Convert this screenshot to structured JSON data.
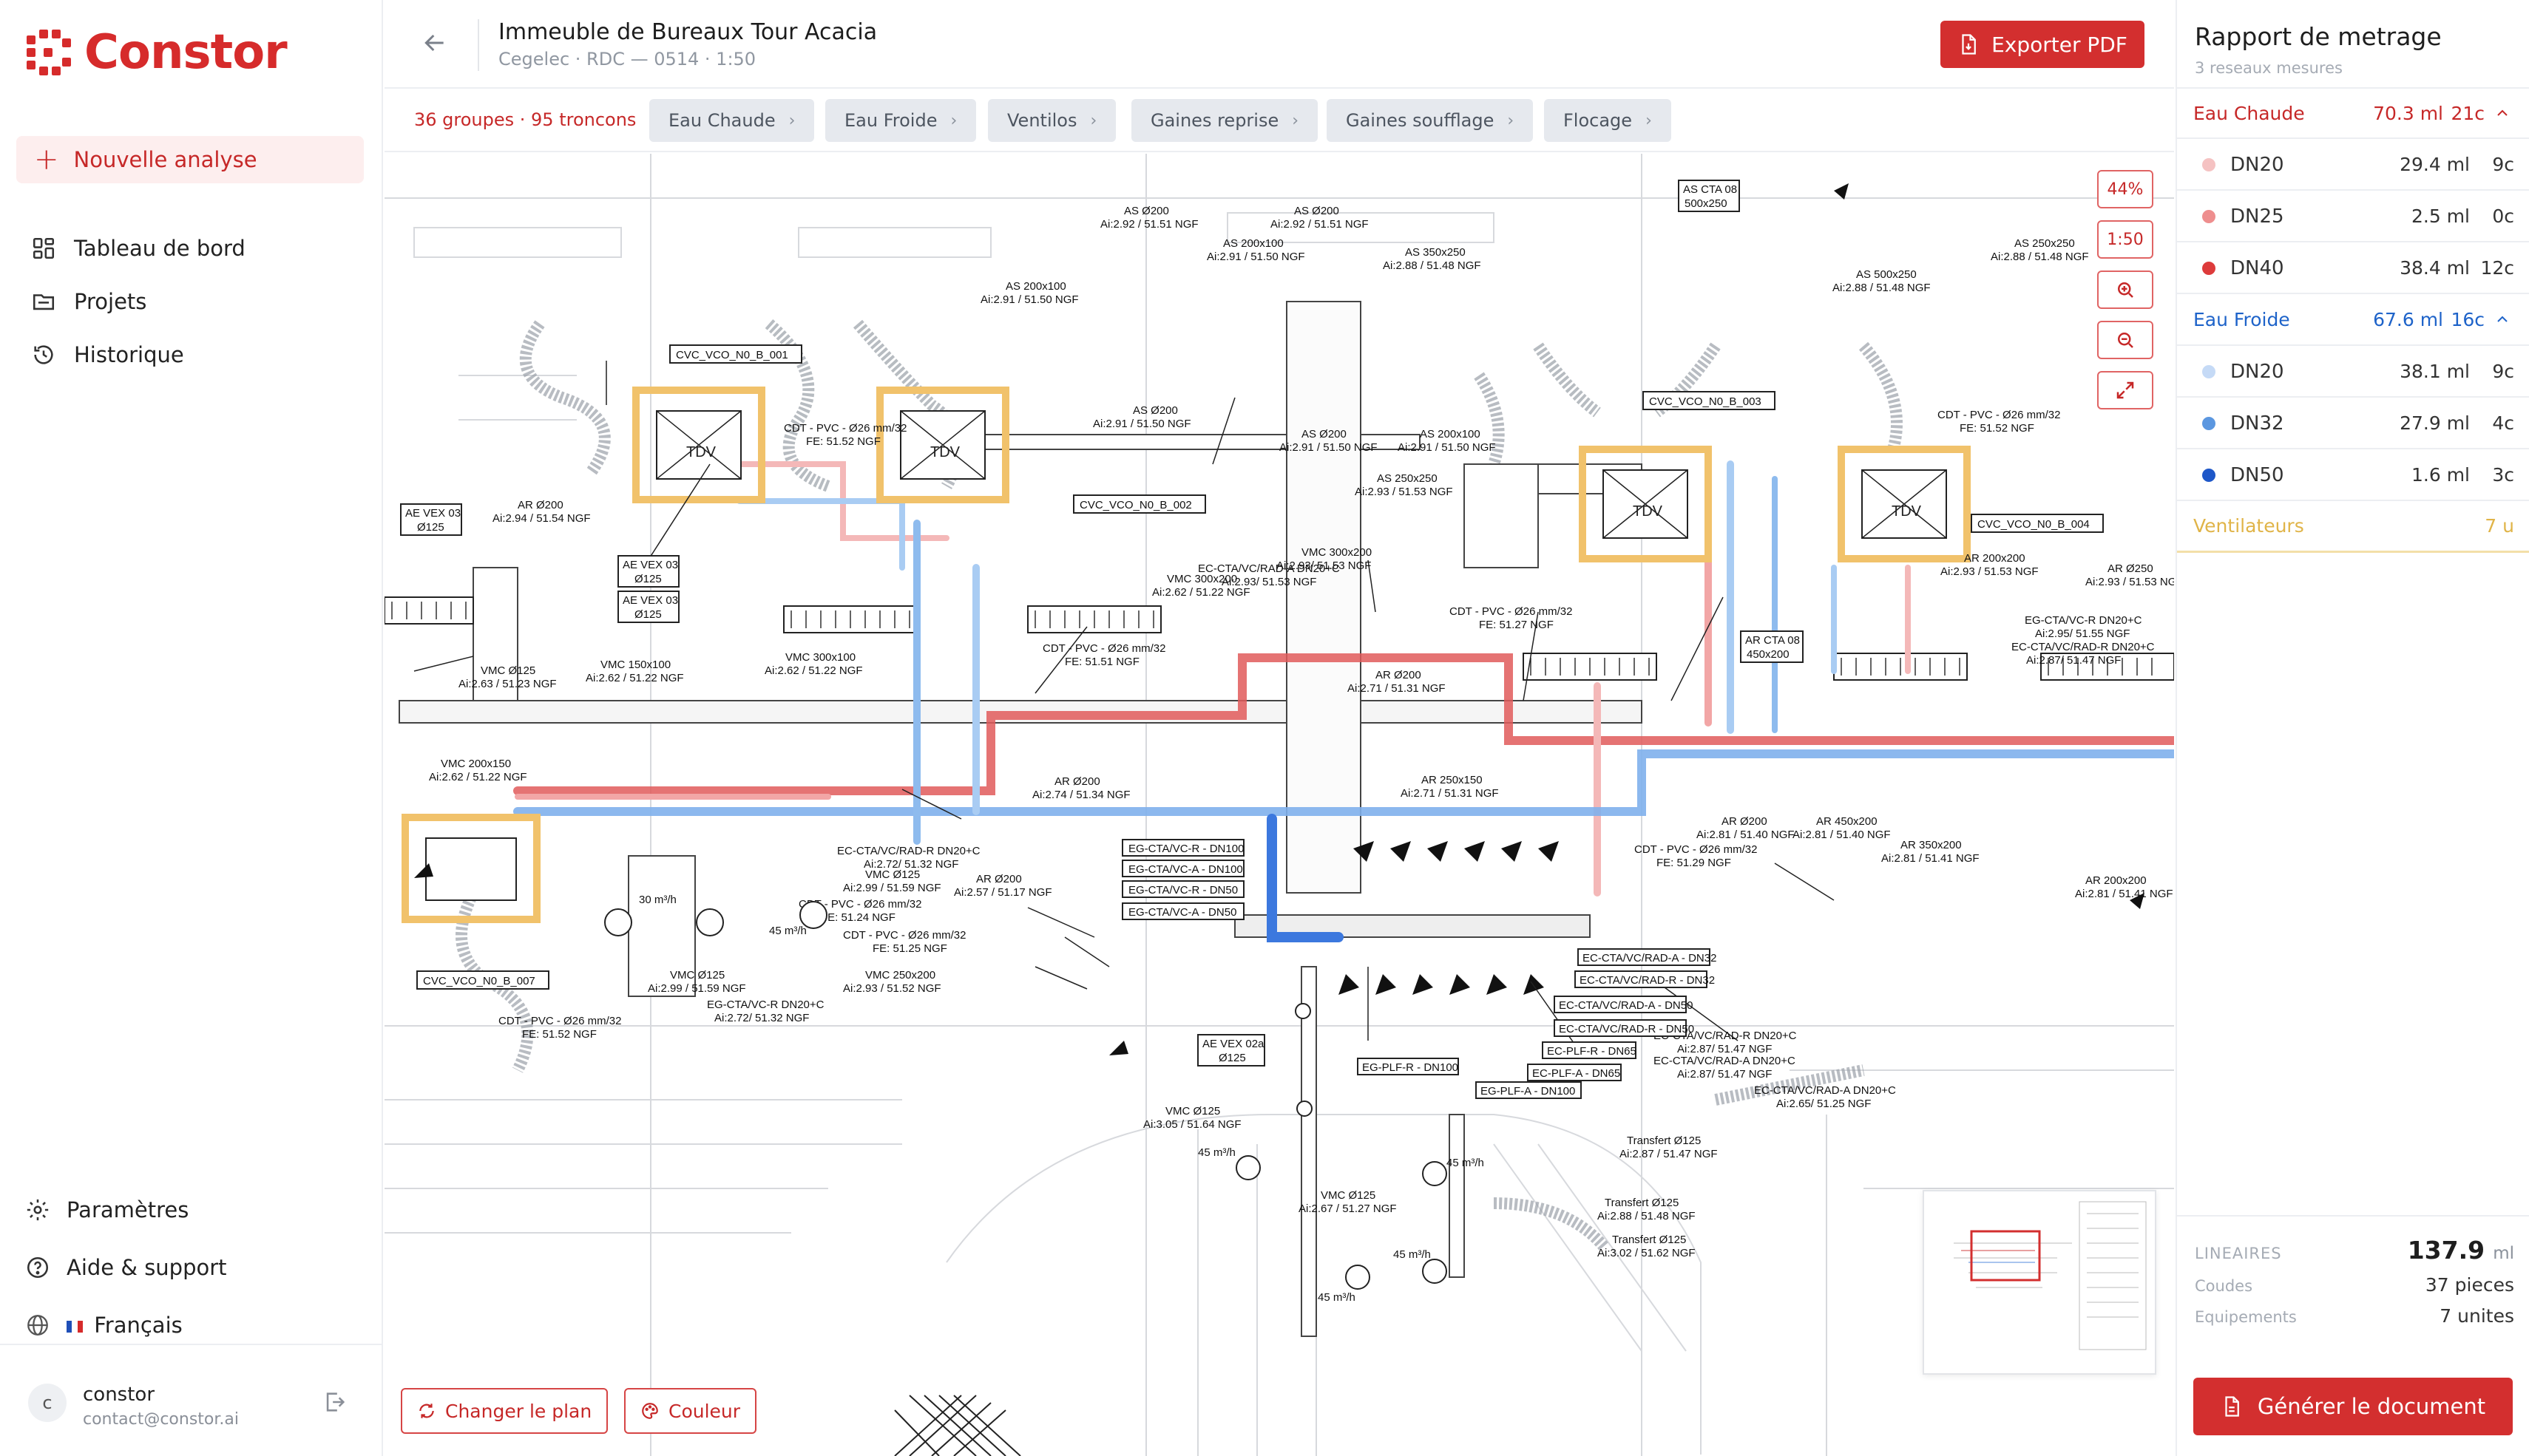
{
  "app": {
    "name": "Constor",
    "brand_color": "#d62b2b"
  },
  "sidebar": {
    "new_analysis": "Nouvelle analyse",
    "nav": [
      {
        "label": "Tableau de bord",
        "icon": "dashboard-icon"
      },
      {
        "label": "Projets",
        "icon": "folder-icon"
      },
      {
        "label": "Historique",
        "icon": "history-icon"
      }
    ],
    "bottom": [
      {
        "label": "Paramètres",
        "icon": "gear-icon"
      },
      {
        "label": "Aide & support",
        "icon": "help-icon"
      },
      {
        "label": "Français",
        "icon": "globe-icon"
      }
    ],
    "user": {
      "initial": "c",
      "name": "constor",
      "email": "contact@constor.ai"
    }
  },
  "header": {
    "title": "Immeuble de Bureaux Tour Acacia",
    "subtitle": "Cegelec · RDC — 0514 · 1:50",
    "export_label": "Exporter PDF"
  },
  "filters": {
    "count": "36 groupes · 95 troncons",
    "chips": [
      "Eau Chaude",
      "Eau Froide",
      "Ventilos",
      "Gaines reprise",
      "Gaines soufflage",
      "Flocage"
    ]
  },
  "canvas": {
    "zoom": "44%",
    "scale": "1:50",
    "change_plan": "Changer le plan",
    "color": "Couleur",
    "labels": {
      "vco_001": "CVC_VCO_N0_B_001",
      "vco_002": "CVC_VCO_N0_B_002",
      "vco_003": "CVC_VCO_N0_B_003",
      "vco_004": "CVC_VCO_N0_B_004",
      "vco_007": "CVC_VCO_N0_B_007",
      "tdv": "TDV",
      "ae_vex_03": "AE VEX 03",
      "o125": "Ø125",
      "ae_vex_02a": "AE VEX 02a",
      "as_cta_08": "AS CTA 08",
      "as_cta_08_size": "500x250",
      "ar_cta_08": "AR CTA 08",
      "ar_cta_08_size": "450x200",
      "cdt": "CDT - PVC - Ø26 mm/32",
      "fe1": "FE: 51.52 NGF",
      "fe2": "FE: 51.51 NGF",
      "fe3": "FE: 51.27 NGF",
      "fe4": "FE: 51.24 NGF",
      "fe5": "FE: 51.25 NGF",
      "fe6": "FE: 51.29 NGF",
      "as200": "AS Ø200",
      "as200_ai": "Ai:2.92 / 51.51 NGF",
      "as200x100": "AS 200x100",
      "as200x100_ai": "Ai:2.91 / 51.50 NGF",
      "as350x250": "AS 350x250",
      "as350x250_ai": "Ai:2.88 / 51.48 NGF",
      "as500x250": "AS 500x250",
      "as250x250": "AS 250x250",
      "as250x250_ai": "Ai:2.93 / 51.53 NGF",
      "ar200": "AR Ø200",
      "ar200_ai": "Ai:2.94 / 51.54 NGF",
      "ar250x150": "AR 250x150",
      "ar250x150_ai": "Ai:2.71 / 51.31 NGF",
      "ar450x200": "AR 450x200",
      "ar450x200_ai": "Ai:2.81 / 51.40 NGF",
      "ar350x200": "AR 350x200",
      "ar350x200_ai": "Ai:2.81 / 51.41 NGF",
      "ar200x200": "AR 200x200",
      "ar250": "AR Ø250",
      "vmc125": "VMC Ø125",
      "vmc125_ai": "Ai:2.63 / 51.23 NGF",
      "vmc150x100": "VMC 150x100",
      "vmc150x100_ai": "Ai:2.62 / 51.22 NGF",
      "vmc300x100": "VMC 300x100",
      "vmc300x200": "VMC 300x200",
      "vmc200x150": "VMC 200x150",
      "vmc250x200": "VMC 250x200",
      "vmc250x200_ai": "Ai:2.93 / 51.52 NGF",
      "vmc125b_ai": "Ai:2.99 / 51.59 NGF",
      "vmc125c_ai": "Ai:3.05 / 51.64 NGF",
      "vmc125d_ai": "Ai:2.67 / 51.27 NGF",
      "ec_cta": "EC-CTA/VC/RAD-A DN20+C",
      "ec_cta_ai": "Ai:2.93/ 51.53 NGF",
      "ec_cta_r": "EC-CTA/VC/RAD-R DN20+C",
      "ec_cta_r_ai": "Ai:2.72/ 51.32 NGF",
      "ec_cta_r2": "EC-CTA/VC/RAD-R DN20+C",
      "ec_cta_r2_ai": "Ai:2.87/ 51.47 NGF",
      "ec_cta_a2": "EC-CTA/VC/RAD-A DN20+C",
      "ec_cta_a2_ai": "Ai:2.65/ 51.25 NGF",
      "eg_cta_r": "EG-CTA/VC-R DN20+C",
      "eg_cta_r_ai": "Ai:2.95/ 51.55 NGF",
      "eg_cta_a": "EG-CTA/VC-R DN20+C",
      "eg_vc_r100": "EG-CTA/VC-R - DN100",
      "eg_vc_a100": "EG-CTA/VC-A - DN100",
      "eg_vc_r50": "EG-CTA/VC-R - DN50",
      "eg_vc_a50": "EG-CTA/VC-A - DN50",
      "ec_rad_a32": "EC-CTA/VC/RAD-A - DN32",
      "ec_rad_r32": "EC-CTA/VC/RAD-R - DN32",
      "ec_rad_a50": "EC-CTA/VC/RAD-A - DN50",
      "ec_rad_r50": "EC-CTA/VC/RAD-R - DN50",
      "ec_plf_r": "EC-PLF-R - DN65",
      "ec_plf_a": "EC-PLF-A - DN65",
      "eg_plf_r": "EG-PLF-R - DN100",
      "eg_plf_a": "EG-PLF-A - DN100",
      "transfert": "Transfert Ø125",
      "transfert_ai1": "Ai:2.87 / 51.47 NGF",
      "transfert_ai2": "Ai:2.88 / 51.48 NGF",
      "transfert_ai3": "Ai:3.02 / 51.62 NGF",
      "m3h30": "30 m³/h",
      "m3h45": "45 m³/h",
      "ar200b_ai": "Ai:2.57 / 51.17 NGF",
      "ar200c_ai": "Ai:2.74 / 51.34 NGF"
    }
  },
  "report": {
    "title": "Rapport de metrage",
    "subtitle": "3 reseaux mesures",
    "groups": [
      {
        "name": "Eau Chaude",
        "ml": "70.3 ml",
        "count": "21c",
        "color": "#c62828",
        "rows": [
          {
            "name": "DN20",
            "ml": "29.4 ml",
            "count": "9c",
            "dot": "#f5c2c2"
          },
          {
            "name": "DN25",
            "ml": "2.5 ml",
            "count": "0c",
            "dot": "#ee8e8e"
          },
          {
            "name": "DN40",
            "ml": "38.4 ml",
            "count": "12c",
            "dot": "#dd3b3b"
          }
        ]
      },
      {
        "name": "Eau Froide",
        "ml": "67.6 ml",
        "count": "16c",
        "color": "#1e63c9",
        "rows": [
          {
            "name": "DN20",
            "ml": "38.1 ml",
            "count": "9c",
            "dot": "#c5daf6"
          },
          {
            "name": "DN32",
            "ml": "27.9 ml",
            "count": "4c",
            "dot": "#5b97e0"
          },
          {
            "name": "DN50",
            "ml": "1.6 ml",
            "count": "3c",
            "dot": "#1e57c8"
          }
        ]
      },
      {
        "name": "Ventilateurs",
        "ml": "",
        "count": "7 u",
        "color": "#e0b448",
        "rows": []
      }
    ],
    "summary": {
      "lineaires_label": "LINEAIRES",
      "lineaires_value": "137.9",
      "lineaires_unit": "ml",
      "coudes_label": "Coudes",
      "coudes_value": "37 pieces",
      "equip_label": "Equipements",
      "equip_value": "7 unites"
    },
    "generate_label": "Générer le document"
  }
}
